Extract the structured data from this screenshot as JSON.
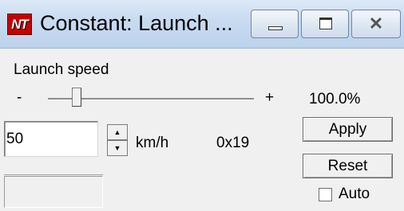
{
  "window": {
    "title": "Constant: Launch ...",
    "icon": "nt-app-icon",
    "icon_text": "NT",
    "controls": {
      "minimize": "minimize-icon",
      "maximize": "maximize-icon",
      "close": "close-icon"
    }
  },
  "panel": {
    "heading": "Launch speed",
    "slider": {
      "min_label": "-",
      "max_label": "+",
      "percent_text": "100.0%",
      "level": 0.14
    },
    "value_input": "50",
    "unit": "km/h",
    "hex_value": "0x19",
    "apply_label": "Apply",
    "reset_label": "Reset",
    "auto_label": "Auto",
    "auto_checked": false
  }
}
